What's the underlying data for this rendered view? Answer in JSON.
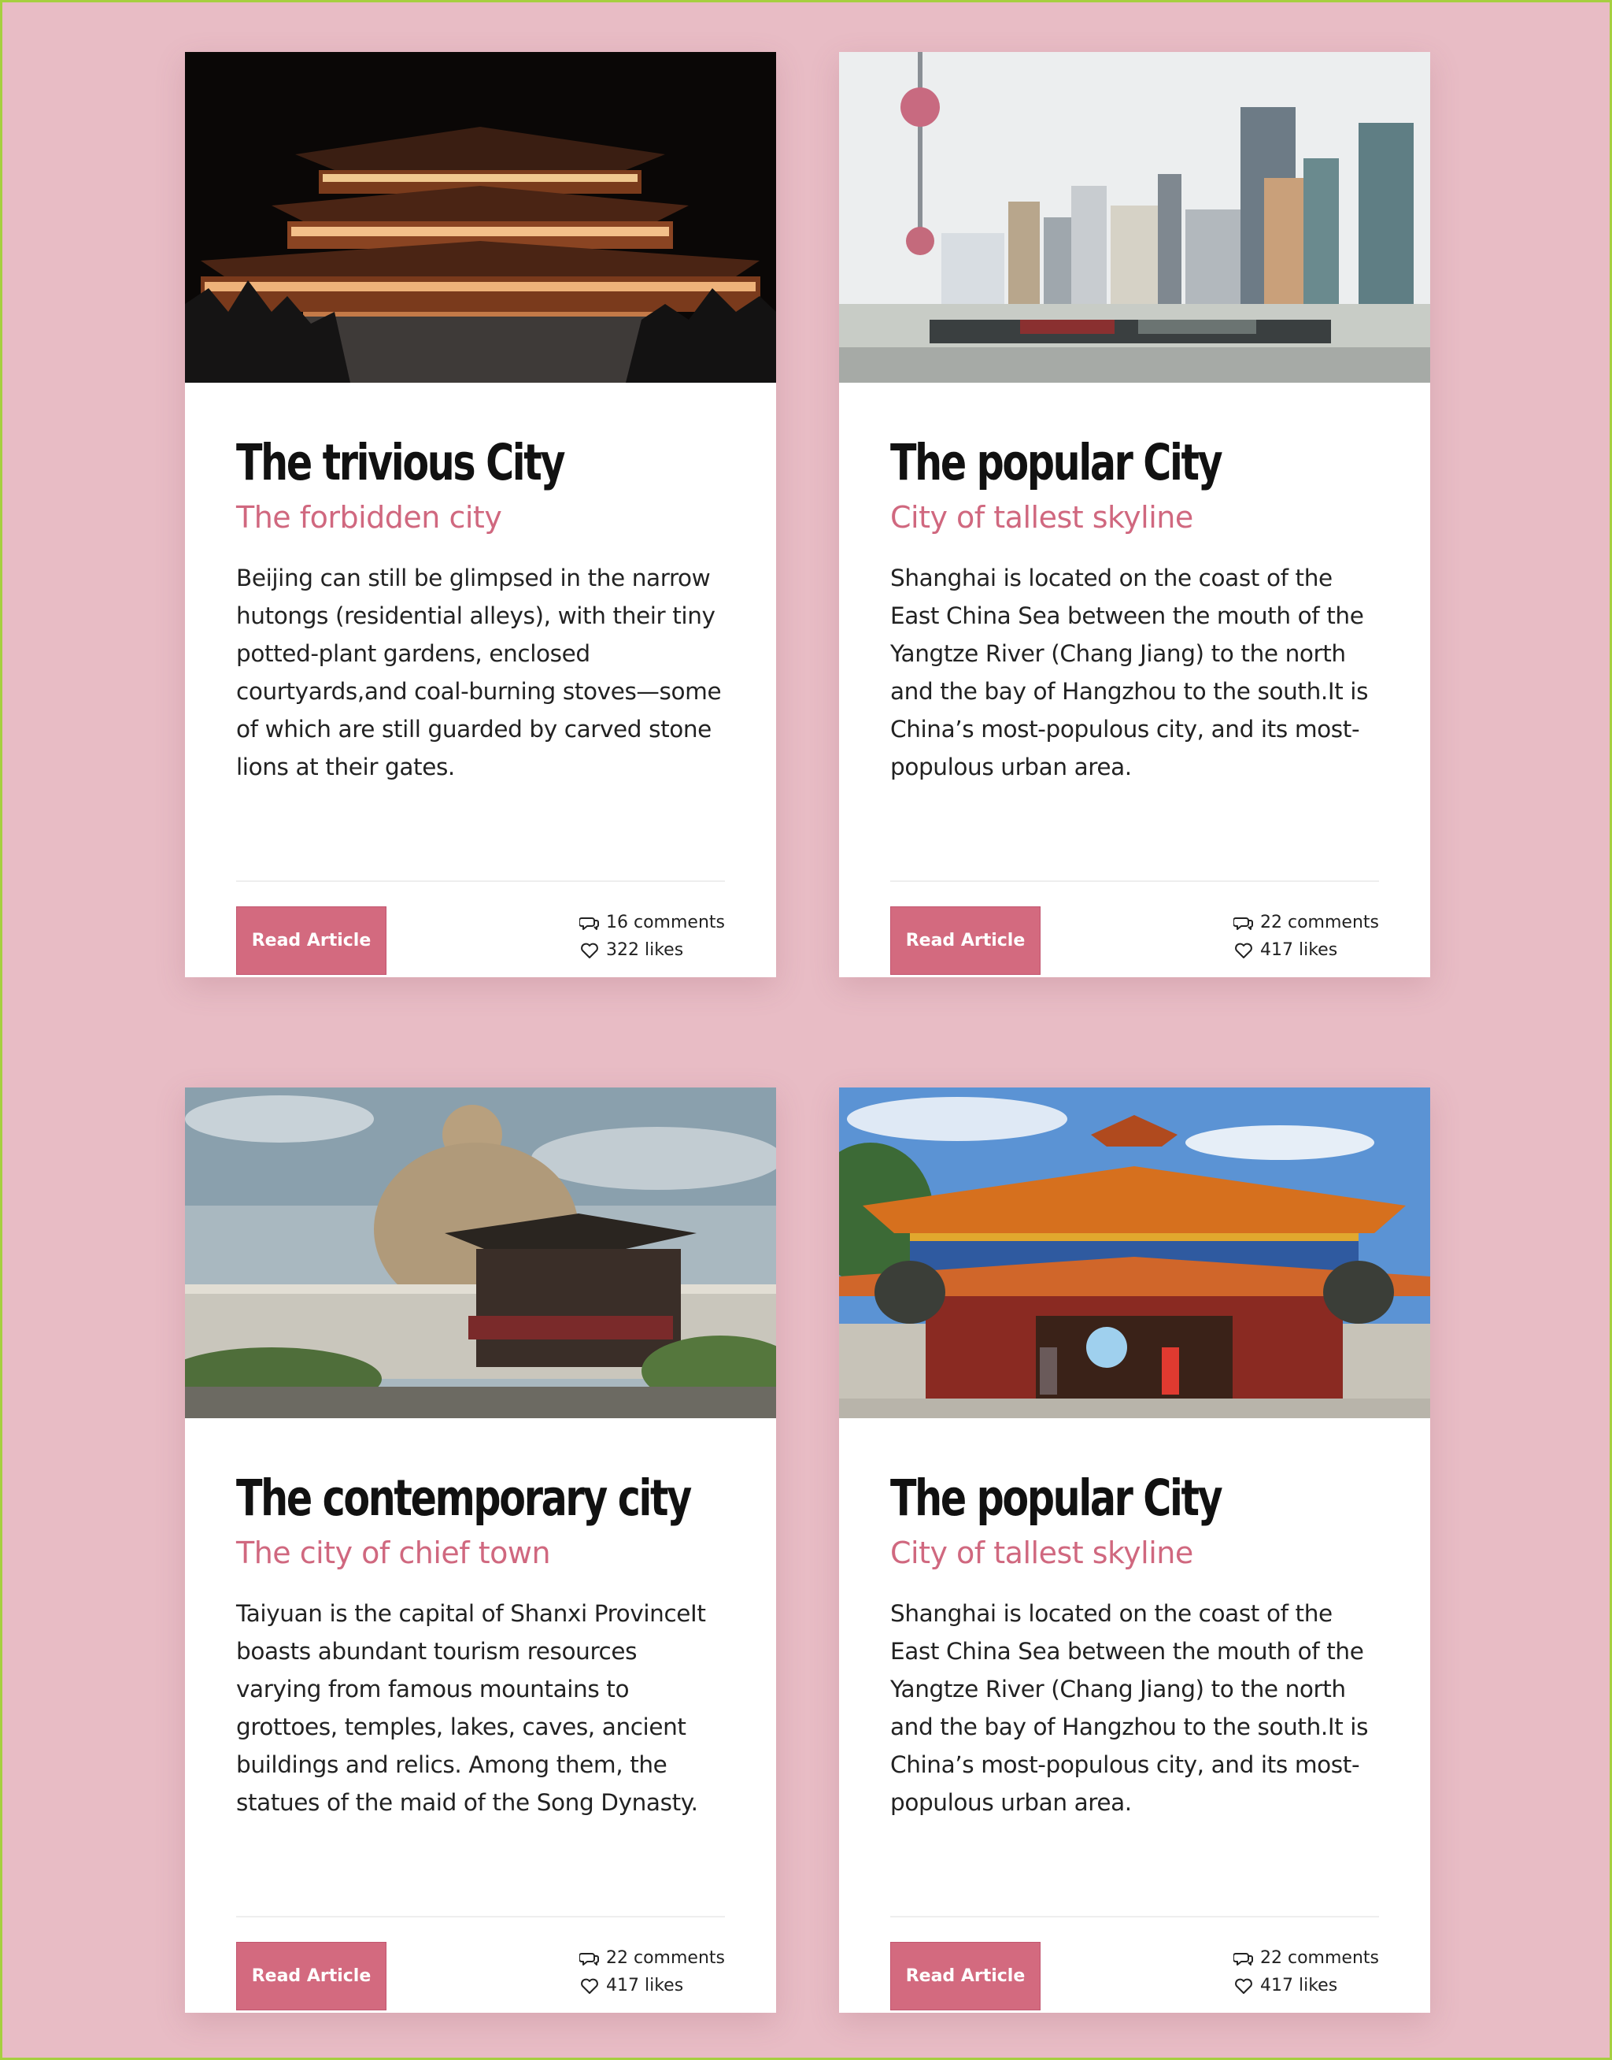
{
  "colors": {
    "page_background": "#e8bcc5",
    "page_border": "#a6cf3f",
    "accent": "#d36a7f",
    "subtitle": "#d0687f"
  },
  "cards": [
    {
      "image": "night-pagoda-photo",
      "title": "The trivious City",
      "subtitle": "The forbidden city",
      "text": "Beijing can still be glimpsed in the narrow hutongs (residential alleys), with their tiny potted-plant gardens, enclosed courtyards,and coal-burning stoves—some of which are still guarded by carved stone lions at their gates.",
      "button": "Read Article",
      "comments": "16 comments",
      "likes": "322 likes"
    },
    {
      "image": "shanghai-skyline-photo",
      "title": "The popular City",
      "subtitle": "City of tallest skyline",
      "text": "Shanghai is located on the coast of the East China Sea between the mouth of the Yangtze River (Chang Jiang) to the north and the bay of Hangzhou to the south.It is China’s most-populous city, and its most-populous urban area.",
      "button": "Read Article",
      "comments": "22 comments",
      "likes": "417 likes"
    },
    {
      "image": "buddha-statue-photo",
      "title": "The contemporary city",
      "subtitle": "The city of chief town",
      "text": "Taiyuan is the capital of Shanxi ProvinceIt boasts abundant tourism resources varying from famous mountains to grottoes, temples, lakes, caves, ancient buildings and relics. Among them, the statues of the maid of the Song Dynasty.",
      "button": "Read Article",
      "comments": "22 comments",
      "likes": "417 likes"
    },
    {
      "image": "temple-gate-photo",
      "title": "The popular City",
      "subtitle": "City of tallest skyline",
      "text": "Shanghai is located on the coast of the East China Sea between the mouth of the Yangtze River (Chang Jiang) to the north and the bay of Hangzhou to the south.It is China’s most-populous city, and its most-populous urban area.",
      "button": "Read Article",
      "comments": "22 comments",
      "likes": "417 likes"
    }
  ]
}
